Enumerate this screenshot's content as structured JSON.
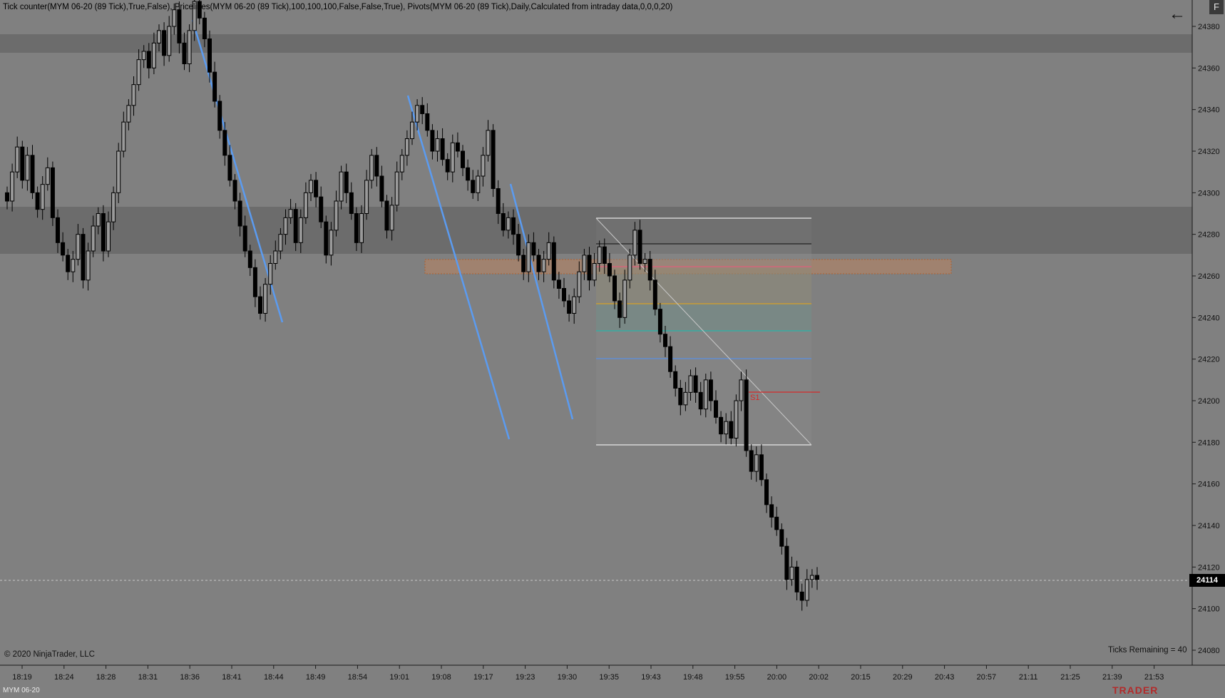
{
  "indicators_text": "Tick counter(MYM 06-20 (89 Tick),True,False), Pricelines(MYM 06-20 (89 Tick),100,100,100,False,False,True), Pivots(MYM 06-20 (89 Tick),Daily,Calculated from intraday data,0,0,0,20)",
  "copyright": "© 2020 NinjaTrader, LLC",
  "ticks_remaining": "Ticks Remaining = 40",
  "instrument": "MYM 06-20",
  "brand": "TRADER",
  "f_button": "F",
  "back_icon": "back-arrow-icon",
  "last_price": "24114",
  "pivot_label": "S1",
  "price_axis_labels": [
    "24380",
    "24360",
    "24340",
    "24320",
    "24300",
    "24280",
    "24260",
    "24240",
    "24220",
    "24200",
    "24180",
    "24160",
    "24140",
    "24120",
    "24100",
    "24080"
  ],
  "time_axis_labels": [
    "18:19",
    "18:24",
    "18:28",
    "18:31",
    "18:36",
    "18:41",
    "18:44",
    "18:49",
    "18:54",
    "19:01",
    "19:08",
    "19:17",
    "19:23",
    "19:30",
    "19:35",
    "19:43",
    "19:48",
    "19:55",
    "20:00",
    "20:02",
    "20:15",
    "20:29",
    "20:43",
    "20:57",
    "21:11",
    "21:25",
    "21:39",
    "21:53"
  ],
  "colors": {
    "background": "#808080",
    "zone": "#6c6c6c",
    "trendline": "#5b9bf0",
    "candle": "#000000",
    "box_fill": "#c8845a",
    "s1": "#d42a2a"
  },
  "chart_data": {
    "type": "candlestick",
    "ylim": [
      24075,
      24390
    ],
    "close_series": [
      24296,
      24310,
      24322,
      24306,
      24318,
      24300,
      24292,
      24304,
      24312,
      24288,
      24276,
      24270,
      24262,
      24268,
      24280,
      24258,
      24272,
      24284,
      24290,
      24272,
      24286,
      24300,
      24320,
      24334,
      24342,
      24352,
      24364,
      24368,
      24360,
      24372,
      24378,
      24366,
      24380,
      24388,
      24372,
      24362,
      24378,
      24392,
      24384,
      24374,
      24358,
      24344,
      24330,
      24318,
      24306,
      24296,
      24284,
      24272,
      24264,
      24250,
      24242,
      24256,
      24266,
      24272,
      24280,
      24288,
      24292,
      24276,
      24288,
      24300,
      24306,
      24298,
      24286,
      24270,
      24282,
      24296,
      24310,
      24300,
      24290,
      24276,
      24290,
      24306,
      24318,
      24308,
      24296,
      24282,
      24294,
      24310,
      24318,
      24326,
      24334,
      24342,
      24338,
      24330,
      24320,
      24326,
      24316,
      24310,
      24324,
      24320,
      24312,
      24306,
      24300,
      24308,
      24318,
      24330,
      24302,
      24290,
      24282,
      24288,
      24280,
      24270,
      24262,
      24276,
      24270,
      24262,
      24268,
      24276,
      24258,
      24254,
      24248,
      24242,
      24250,
      24262,
      24270,
      24258,
      24266,
      24274,
      24266,
      24260,
      24248,
      24240,
      24258,
      24270,
      24282,
      24266,
      24268,
      24258,
      24244,
      24232,
      24226,
      24214,
      24206,
      24198,
      24204,
      24212,
      24204,
      24196,
      24210,
      24200,
      24192,
      24184,
      24190,
      24182,
      24200,
      24210,
      24176,
      24166,
      24174,
      24162,
      24150,
      24144,
      24138,
      24130,
      24114,
      24120,
      24108,
      24104,
      24114,
      24116,
      24114
    ]
  }
}
